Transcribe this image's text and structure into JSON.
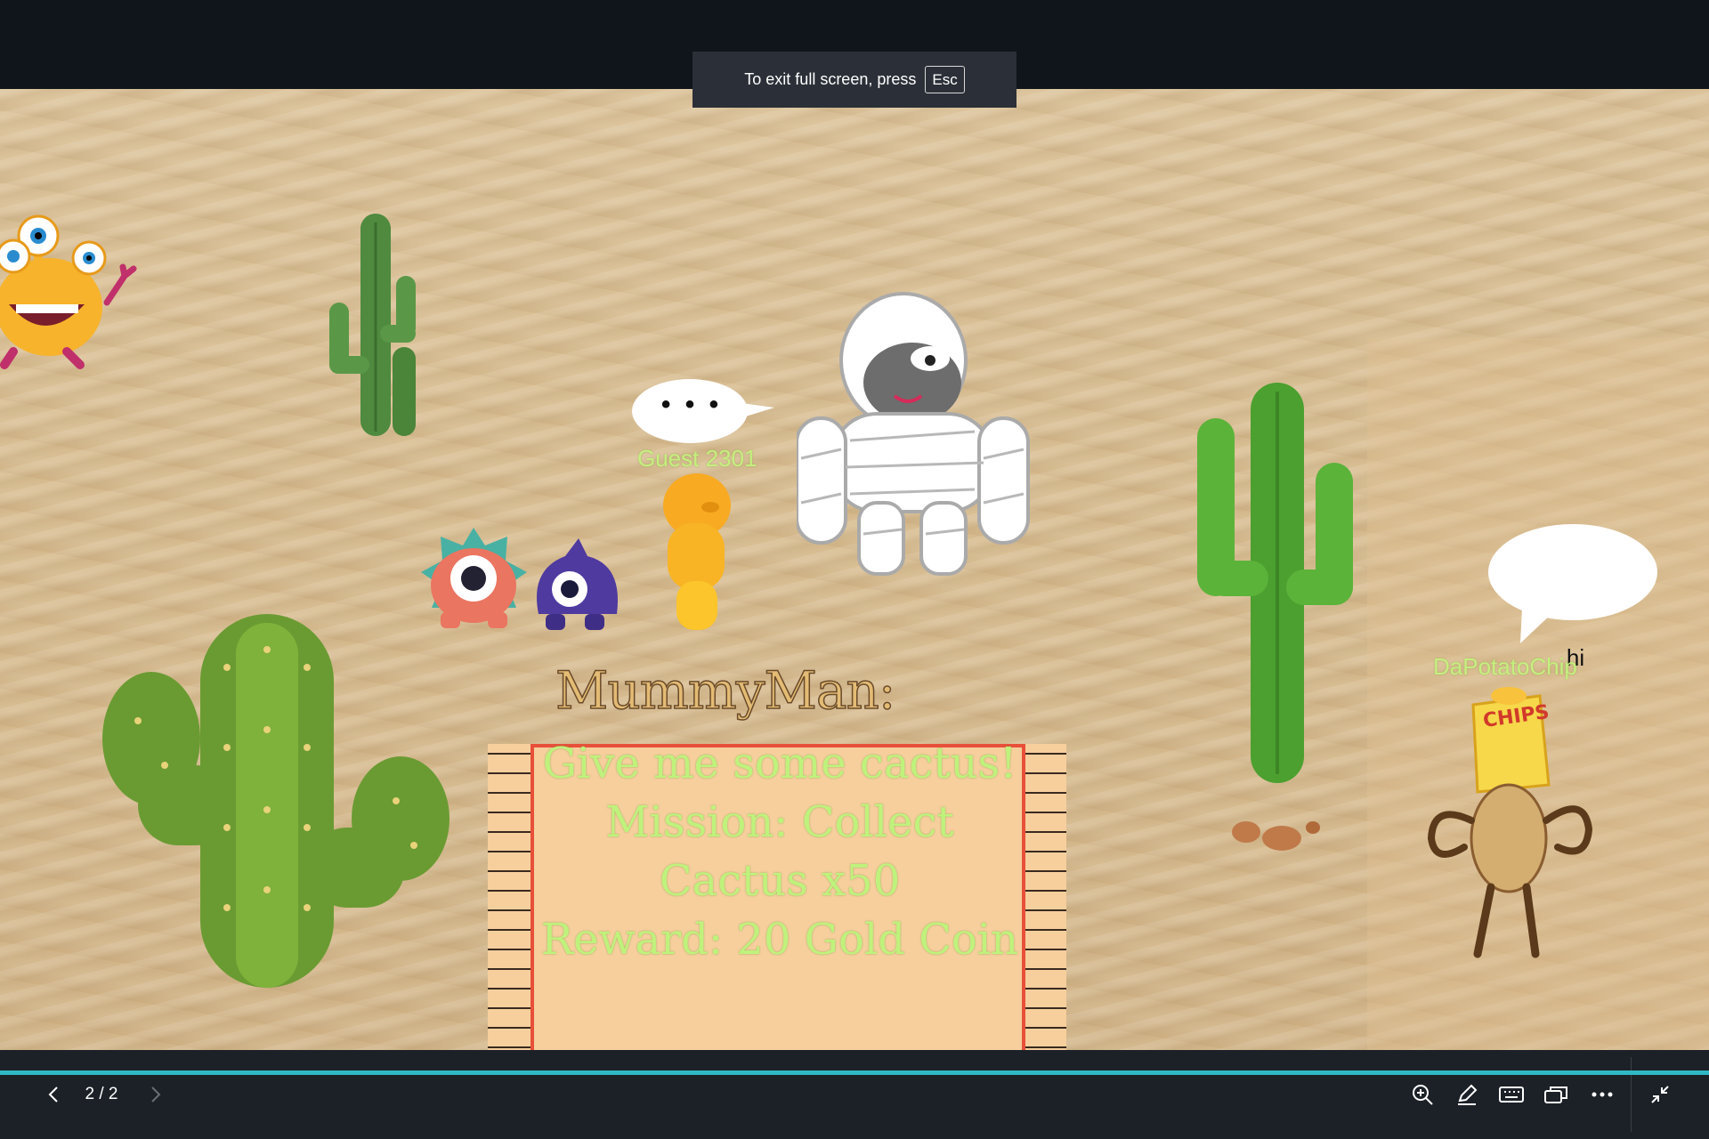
{
  "toast": {
    "text": "To exit full screen, press",
    "key": "Esc"
  },
  "scene": {
    "thought_bubble": "• • •",
    "player_guest": "Guest 2301",
    "player_chip": "DaPotatoChip",
    "chat_bubble": "hi",
    "chips_bag_label": "CHIPS"
  },
  "quest": {
    "title": "MummyMan:",
    "lines": [
      "Give me some cactus!",
      "Mission: Collect",
      "Cactus x50",
      "Reward: 20 Gold Coin"
    ]
  },
  "player": {
    "page_indicator": "2 / 2",
    "progress_fraction": 1.0,
    "accent_color": "#2fb9c6"
  },
  "icons": {
    "prev": "chevron-left-icon",
    "next": "chevron-right-icon",
    "zoom": "zoom-in-icon",
    "pen": "pen-icon",
    "keyboard": "keyboard-icon",
    "windows": "window-switch-icon",
    "more": "more-icon",
    "exit_fullscreen": "exit-fullscreen-icon"
  }
}
